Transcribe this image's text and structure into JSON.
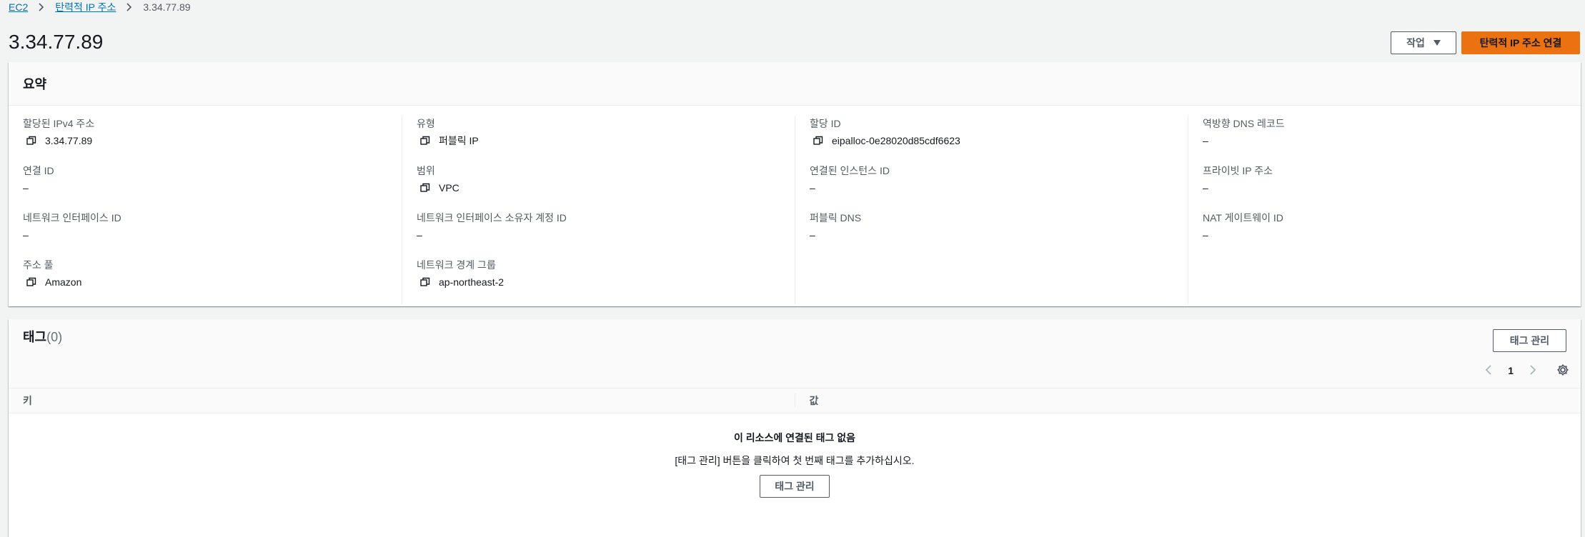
{
  "breadcrumb": {
    "items": [
      "EC2",
      "탄력적 IP 주소"
    ],
    "current": "3.34.77.89"
  },
  "header": {
    "title": "3.34.77.89",
    "actions_label": "작업",
    "primary_label": "탄력적 IP 주소 연결"
  },
  "summary": {
    "title": "요약",
    "columns": [
      [
        {
          "label": "할당된 IPv4 주소",
          "value": "3.34.77.89",
          "copy": true
        },
        {
          "label": "연결 ID",
          "value": "–",
          "copy": false
        },
        {
          "label": "네트워크 인터페이스 ID",
          "value": "–",
          "copy": false
        },
        {
          "label": "주소 풀",
          "value": "Amazon",
          "copy": true
        }
      ],
      [
        {
          "label": "유형",
          "value": "퍼블릭 IP",
          "copy": true
        },
        {
          "label": "범위",
          "value": "VPC",
          "copy": true
        },
        {
          "label": "네트워크 인터페이스 소유자 계정 ID",
          "value": "–",
          "copy": false
        },
        {
          "label": "네트워크 경계 그룹",
          "value": "ap-northeast-2",
          "copy": true
        }
      ],
      [
        {
          "label": "할당 ID",
          "value": "eipalloc-0e28020d85cdf6623",
          "copy": true
        },
        {
          "label": "연결된 인스턴스 ID",
          "value": "–",
          "copy": false
        },
        {
          "label": "퍼블릭 DNS",
          "value": "–",
          "copy": false
        }
      ],
      [
        {
          "label": "역방향 DNS 레코드",
          "value": "–",
          "copy": false
        },
        {
          "label": "프라이빗 IP 주소",
          "value": "–",
          "copy": false
        },
        {
          "label": "NAT 게이트웨이 ID",
          "value": "–",
          "copy": false
        }
      ]
    ]
  },
  "tags": {
    "title": "태그",
    "count": "(0)",
    "manage_label": "태그 관리",
    "page": "1",
    "columns": [
      "키",
      "값"
    ],
    "empty_title": "이 리소스에 연결된 태그 없음",
    "empty_desc": "[태그 관리] 버튼을 클릭하여 첫 번째 태그를 추가하십시오.",
    "empty_button": "태그 관리"
  },
  "icons": {
    "copy": "copy-icon",
    "settings": "gear-icon",
    "prev": "chevron-left-icon",
    "next": "chevron-right-icon"
  },
  "colors": {
    "link": "#0073bb",
    "primary": "#ec7211",
    "text": "#16191f",
    "muted": "#545b64"
  }
}
